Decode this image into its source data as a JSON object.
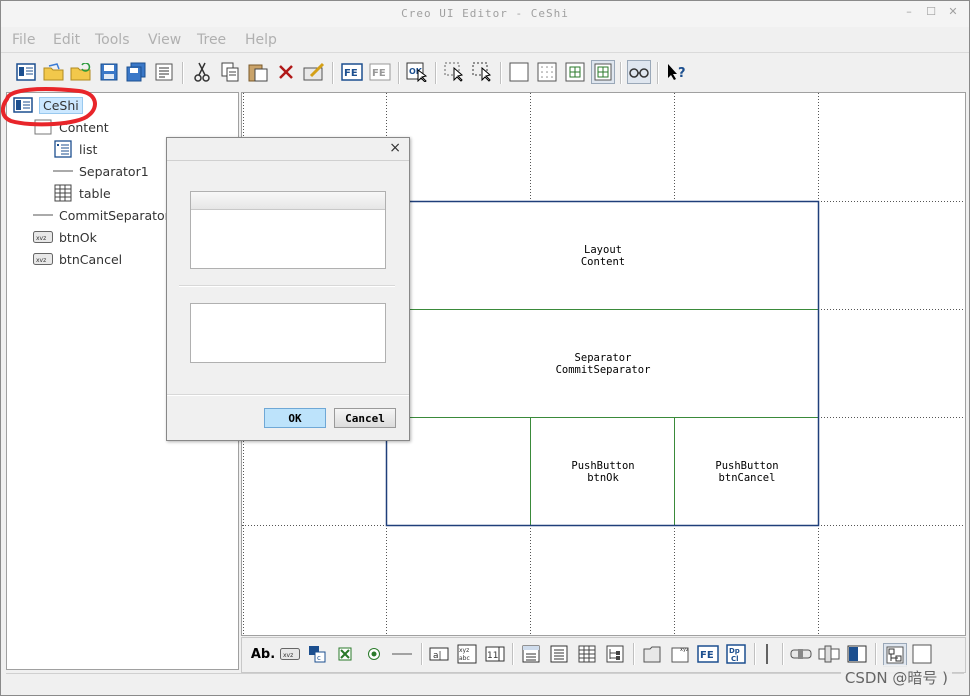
{
  "window": {
    "title": "Creo UI Editor - CeShi",
    "controls": {
      "minimize": "–",
      "maximize": "☐",
      "close": "✕"
    }
  },
  "menu": [
    "File",
    "Edit",
    "Tools",
    "View",
    "Tree",
    "Help"
  ],
  "toolbar_icons": [
    "new-dialog-icon",
    "open-folder-icon",
    "open-folder-2-icon",
    "save-icon",
    "save-all-icon",
    "properties-icon",
    "cut-icon",
    "copy-icon",
    "paste-icon",
    "delete-icon",
    "edit-icon",
    "fe-icon",
    "fe-disabled-icon",
    "ok-icon",
    "select-tool-icon",
    "select-tool-2-icon",
    "blank-grid-icon",
    "dot-grid-icon",
    "fine-grid-icon",
    "snap-grid-icon",
    "preview-glasses-icon",
    "help-icon"
  ],
  "tree": {
    "root": "CeShi",
    "items": [
      {
        "label": "Content",
        "icon": "layout-icon"
      },
      {
        "label": "list",
        "icon": "list-icon"
      },
      {
        "label": "Separator1",
        "icon": "separator-icon"
      },
      {
        "label": "table",
        "icon": "table-icon"
      },
      {
        "label": "CommitSeparator",
        "icon": "separator-icon"
      },
      {
        "label": "btnOk",
        "icon": "pushbutton-icon"
      },
      {
        "label": "btnCancel",
        "icon": "pushbutton-icon"
      }
    ],
    "pushbutton_icon_text": "xvz"
  },
  "canvas": {
    "cells": [
      {
        "type": "Layout",
        "name": "Content"
      },
      {
        "type": "Separator",
        "name": "CommitSeparator"
      },
      {
        "type": "PushButton",
        "name": "btnOk"
      },
      {
        "type": "PushButton",
        "name": "btnCancel"
      }
    ]
  },
  "dialog": {
    "close": "×",
    "ok_label": "OK",
    "cancel_label": "Cancel"
  },
  "bottom_toolbar": {
    "label_icon_text": "Ab.",
    "pushbutton_icon_text": "xvz",
    "icons": [
      "label-icon",
      "pushbutton-icon",
      "radio-group-icon",
      "checkbox-icon",
      "radio-icon",
      "separator-icon",
      "inputpanel-icon",
      "textarea-icon",
      "spinbox-icon",
      "listbox-icon",
      "table-icon",
      "drawing-area-icon",
      "optionmenu-icon",
      "tab-icon",
      "layout-icon",
      "fe-icon",
      "dp-icon",
      "vertical-separator-icon",
      "slider-icon",
      "thumbwheel-icon",
      "progressbar-icon",
      "tree-icon",
      "blank-icon"
    ]
  },
  "watermark": "CSDN @暗号 )",
  "colors": {
    "layout_border": "#1f3f7a",
    "cell_border": "#3a8a3a",
    "selection": "#cce8ff",
    "annotation": "#e8252a",
    "ok_button": "#bde3fb"
  }
}
